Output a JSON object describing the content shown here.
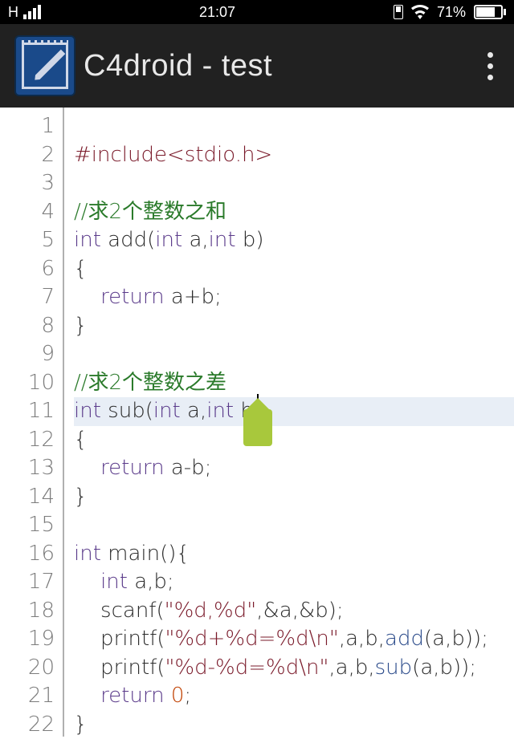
{
  "statusbar": {
    "network": "H",
    "time": "21:07",
    "battery_pct": "71%"
  },
  "appbar": {
    "title": "C4droid - test"
  },
  "editor": {
    "cursor_line_index": 10,
    "lines": [
      {
        "n": 1,
        "tokens": []
      },
      {
        "n": 2,
        "tokens": [
          {
            "cls": "tok-preproc",
            "t": "#include<stdio.h>"
          }
        ]
      },
      {
        "n": 3,
        "tokens": []
      },
      {
        "n": 4,
        "tokens": [
          {
            "cls": "tok-comment",
            "t": "//求2个整数之和"
          }
        ]
      },
      {
        "n": 5,
        "tokens": [
          {
            "cls": "tok-keyword",
            "t": "int"
          },
          {
            "cls": "",
            "t": " add"
          },
          {
            "cls": "",
            "t": "("
          },
          {
            "cls": "tok-keyword",
            "t": "int"
          },
          {
            "cls": "",
            "t": " a,"
          },
          {
            "cls": "tok-keyword",
            "t": "int"
          },
          {
            "cls": "",
            "t": " b)"
          }
        ]
      },
      {
        "n": 6,
        "tokens": [
          {
            "cls": "",
            "t": "{"
          }
        ]
      },
      {
        "n": 7,
        "tokens": [
          {
            "cls": "",
            "t": "    "
          },
          {
            "cls": "tok-keyword",
            "t": "return"
          },
          {
            "cls": "",
            "t": " a+b;"
          }
        ]
      },
      {
        "n": 8,
        "tokens": [
          {
            "cls": "",
            "t": "}"
          }
        ]
      },
      {
        "n": 9,
        "tokens": []
      },
      {
        "n": 10,
        "tokens": [
          {
            "cls": "tok-comment",
            "t": "//求2个整数之差"
          }
        ]
      },
      {
        "n": 11,
        "tokens": [
          {
            "cls": "tok-keyword",
            "t": "int"
          },
          {
            "cls": "",
            "t": " sub"
          },
          {
            "cls": "",
            "t": "("
          },
          {
            "cls": "tok-keyword",
            "t": "int"
          },
          {
            "cls": "",
            "t": " a,"
          },
          {
            "cls": "tok-keyword",
            "t": "int"
          },
          {
            "cls": "",
            "t": " b)"
          }
        ]
      },
      {
        "n": 12,
        "tokens": [
          {
            "cls": "",
            "t": "{"
          }
        ]
      },
      {
        "n": 13,
        "tokens": [
          {
            "cls": "",
            "t": "    "
          },
          {
            "cls": "tok-keyword",
            "t": "return"
          },
          {
            "cls": "",
            "t": " a-b;"
          }
        ]
      },
      {
        "n": 14,
        "tokens": [
          {
            "cls": "",
            "t": "}"
          }
        ]
      },
      {
        "n": 15,
        "tokens": []
      },
      {
        "n": 16,
        "tokens": [
          {
            "cls": "tok-keyword",
            "t": "int"
          },
          {
            "cls": "",
            "t": " main(){"
          }
        ]
      },
      {
        "n": 17,
        "tokens": [
          {
            "cls": "",
            "t": "    "
          },
          {
            "cls": "tok-keyword",
            "t": "int"
          },
          {
            "cls": "",
            "t": " a,b;"
          }
        ]
      },
      {
        "n": 18,
        "tokens": [
          {
            "cls": "",
            "t": "    scanf("
          },
          {
            "cls": "tok-string",
            "t": "\"%d,%d\""
          },
          {
            "cls": "",
            "t": ",&a,&b);"
          }
        ]
      },
      {
        "n": 19,
        "tokens": [
          {
            "cls": "",
            "t": "    printf("
          },
          {
            "cls": "tok-string",
            "t": "\"%d+%d=%d\\n\""
          },
          {
            "cls": "",
            "t": ",a,b,"
          },
          {
            "cls": "tok-func",
            "t": "add"
          },
          {
            "cls": "",
            "t": "(a,b));"
          }
        ]
      },
      {
        "n": 20,
        "tokens": [
          {
            "cls": "",
            "t": "    printf("
          },
          {
            "cls": "tok-string",
            "t": "\"%d-%d=%d\\n\""
          },
          {
            "cls": "",
            "t": ",a,b,"
          },
          {
            "cls": "tok-func",
            "t": "sub"
          },
          {
            "cls": "",
            "t": "(a,b));"
          }
        ]
      },
      {
        "n": 21,
        "tokens": [
          {
            "cls": "",
            "t": "    "
          },
          {
            "cls": "tok-keyword",
            "t": "return"
          },
          {
            "cls": "",
            "t": " "
          },
          {
            "cls": "tok-num",
            "t": "0"
          },
          {
            "cls": "",
            "t": ";"
          }
        ]
      },
      {
        "n": 22,
        "tokens": [
          {
            "cls": "",
            "t": "}"
          }
        ]
      }
    ]
  }
}
